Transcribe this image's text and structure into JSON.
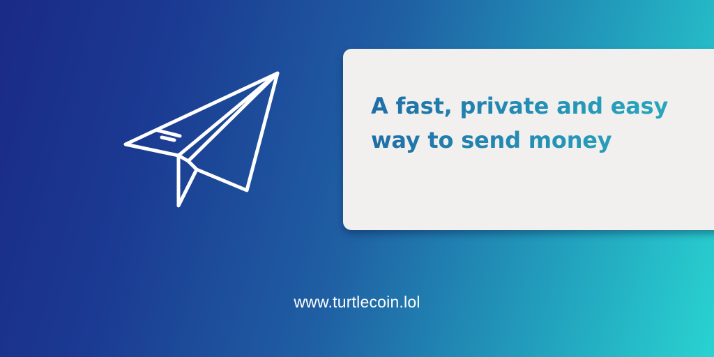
{
  "colors": {
    "gradient_start": "#1a2a86",
    "gradient_end": "#29d3d1",
    "card_background": "#f1f0ef",
    "headline_color": "#2490b4",
    "url_color": "#ffffff"
  },
  "icon": "paper-plane-icon",
  "card": {
    "headline": "A fast, private and easy way to send money"
  },
  "footer": {
    "url": "www.turtlecoin.lol"
  }
}
